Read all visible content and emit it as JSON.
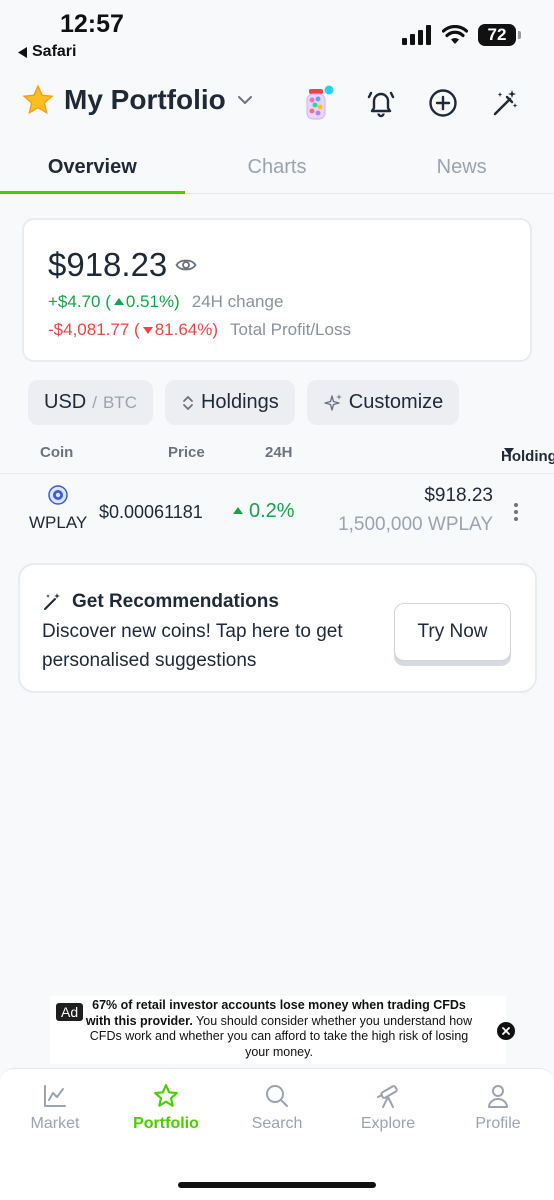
{
  "status_bar": {
    "time": "12:57",
    "back_label": "Safari",
    "battery": "72"
  },
  "header": {
    "title": "My Portfolio",
    "title_icon": "star-emoji-icon",
    "actions": [
      "candy-jar-icon",
      "bell-icon",
      "plus-circle-icon",
      "magic-wand-icon"
    ]
  },
  "tabs": [
    {
      "label": "Overview",
      "active": true
    },
    {
      "label": "Charts",
      "active": false
    },
    {
      "label": "News",
      "active": false
    }
  ],
  "summary": {
    "total_value": "$918.23",
    "change_24h_amount": "+$4.70 (",
    "change_24h_pct": "0.51%)",
    "change_24h_label": "24H change",
    "profit_loss_amount": "-$4,081.77 (",
    "profit_loss_pct": "81.64%)",
    "profit_loss_label": "Total Profit/Loss"
  },
  "filters": {
    "currency_primary": "USD",
    "currency_separator": "/",
    "currency_secondary": "BTC",
    "holdings_label": "Holdings",
    "customize_label": "Customize"
  },
  "table": {
    "headers": {
      "coin": "Coin",
      "price": "Price",
      "change": "24H",
      "holdings": "Holdings"
    },
    "rows": [
      {
        "symbol": "WPLAY",
        "price": "$0.00061181",
        "change": "0.2%",
        "holdings_value": "$918.23",
        "holdings_qty": "1,500,000 WPLAY"
      }
    ]
  },
  "recommendations": {
    "title": "Get Recommendations",
    "description": "Discover new coins! Tap here to get personalised suggestions",
    "button_label": "Try Now"
  },
  "ad": {
    "badge": "Ad",
    "bold_text": "67% of retail investor accounts lose money when trading CFDs with this provider.",
    "body_text": "You should consider whether you understand how CFDs work and whether you can afford to take the high risk of losing your money."
  },
  "bottom_nav": [
    {
      "label": "Market",
      "icon": "chart-icon",
      "active": false
    },
    {
      "label": "Portfolio",
      "icon": "star-icon",
      "active": true
    },
    {
      "label": "Search",
      "icon": "search-icon",
      "active": false
    },
    {
      "label": "Explore",
      "icon": "telescope-icon",
      "active": false
    },
    {
      "label": "Profile",
      "icon": "person-icon",
      "active": false
    }
  ],
  "colors": {
    "accent": "#4bcc00",
    "positive": "#16a34a",
    "negative": "#ef4444"
  }
}
